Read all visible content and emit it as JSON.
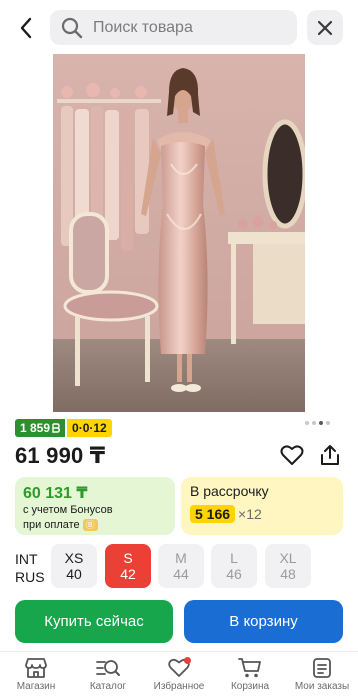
{
  "header": {
    "search_placeholder": "Поиск товара"
  },
  "gallery": {
    "image_alt": "",
    "slides_total": 4,
    "active_slide": 3
  },
  "badges": {
    "bonus_value": "1 859",
    "installment_code": "0·0·12"
  },
  "price": {
    "value": "61 990 ₸"
  },
  "bonus_card": {
    "amount": "60 131 ₸",
    "note_line1": "с учетом Бонусов",
    "note_line2": "при оплате"
  },
  "installment_card": {
    "title": "В рассрочку",
    "monthly": "5 166",
    "months": "×12"
  },
  "sizes": {
    "label_int": "INT",
    "label_rus": "RUS",
    "items": [
      {
        "int": "XS",
        "rus": "40",
        "state": "available"
      },
      {
        "int": "S",
        "rus": "42",
        "state": "selected"
      },
      {
        "int": "M",
        "rus": "44",
        "state": "unavailable"
      },
      {
        "int": "L",
        "rus": "46",
        "state": "unavailable"
      },
      {
        "int": "XL",
        "rus": "48",
        "state": "unavailable"
      }
    ]
  },
  "actions": {
    "buy_now": "Купить сейчас",
    "add_to_cart": "В корзину"
  },
  "nav": {
    "items": [
      {
        "label": "Магазин",
        "icon": "shop-icon"
      },
      {
        "label": "Каталог",
        "icon": "catalog-icon"
      },
      {
        "label": "Избранное",
        "icon": "heart-icon"
      },
      {
        "label": "Корзина",
        "icon": "cart-icon"
      },
      {
        "label": "Мои заказы",
        "icon": "orders-icon"
      }
    ]
  },
  "colors": {
    "buy_green": "#17a64b",
    "cart_blue": "#1a6dd3",
    "selected_red": "#ea4036",
    "bonus_green": "#2d9a2d",
    "installment_yellow": "#ffd400"
  }
}
